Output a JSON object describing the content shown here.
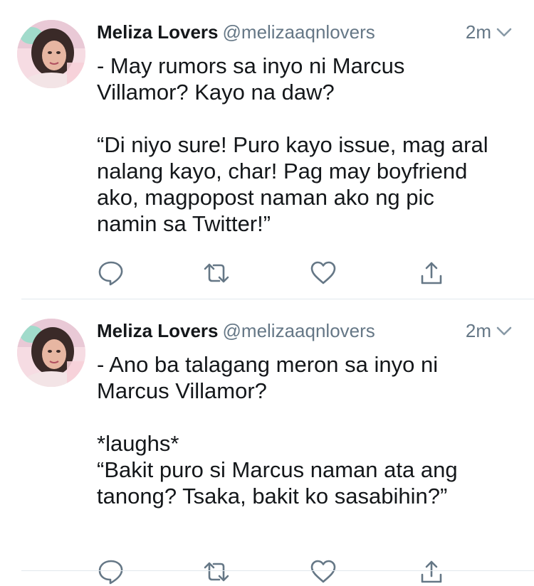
{
  "tweets": [
    {
      "name": "Meliza Lovers",
      "handle": "@melizaaqnlovers",
      "time": "2m",
      "text": "- May rumors sa inyo ni Marcus\nVillamor?  Kayo na daw?\n\n“Di niyo sure! Puro kayo issue, mag aral\nnalang kayo, char! Pag may boyfriend\nako, magpopost naman ako ng pic\nnamin sa Twitter!”"
    },
    {
      "name": "Meliza Lovers",
      "handle": "@melizaaqnlovers",
      "time": "2m",
      "text": "- Ano ba talagang meron sa inyo ni\nMarcus Villamor?\n\n*laughs*\n“Bakit puro si Marcus naman ata ang\ntanong? Tsaka, bakit ko sasabihin?”"
    }
  ],
  "icons": {
    "reply": "reply-icon",
    "retweet": "retweet-icon",
    "like": "heart-icon",
    "share": "share-icon",
    "caret": "chevron-down-icon"
  },
  "colors": {
    "text": "#14171a",
    "secondary": "#657786",
    "icon": "#657786",
    "divider": "#e1e8ed"
  }
}
